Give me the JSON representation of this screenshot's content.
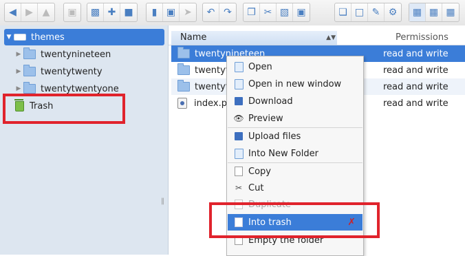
{
  "toolbar": {
    "groups": [
      {
        "buttons": [
          {
            "icon": "back-icon",
            "disabled": false
          },
          {
            "icon": "forward-icon",
            "disabled": true
          },
          {
            "icon": "up-icon",
            "disabled": true
          }
        ]
      },
      {
        "buttons": [
          {
            "icon": "home-icon",
            "disabled": true
          }
        ]
      },
      {
        "buttons": [
          {
            "icon": "open-icon",
            "disabled": false
          },
          {
            "icon": "new-file-icon",
            "disabled": false
          },
          {
            "icon": "save-icon",
            "disabled": false
          }
        ]
      },
      {
        "buttons": [
          {
            "icon": "book-icon",
            "disabled": false
          },
          {
            "icon": "floppy-icon",
            "disabled": false
          },
          {
            "icon": "pointer-icon",
            "disabled": true
          }
        ]
      },
      {
        "buttons": [
          {
            "icon": "undo-icon",
            "disabled": false
          },
          {
            "icon": "redo-icon",
            "disabled": false
          }
        ]
      },
      {
        "buttons": [
          {
            "icon": "copy-icon",
            "disabled": false
          },
          {
            "icon": "cut-icon",
            "disabled": false
          },
          {
            "icon": "paste-icon",
            "disabled": false
          },
          {
            "icon": "delete-icon",
            "disabled": false
          }
        ]
      },
      {
        "buttons": [
          {
            "icon": "duplicate-icon",
            "disabled": false
          },
          {
            "icon": "select-icon",
            "disabled": false
          },
          {
            "icon": "edit-icon",
            "disabled": false
          },
          {
            "icon": "settings-icon",
            "disabled": false
          }
        ]
      },
      {
        "buttons": [
          {
            "icon": "icons-view-icon",
            "active": true
          },
          {
            "icon": "grid-view-icon",
            "active": false
          },
          {
            "icon": "list-view-icon",
            "active": false
          }
        ]
      }
    ]
  },
  "tree": {
    "root": "themes",
    "children": [
      "twentynineteen",
      "twentytwenty",
      "twentytwentyone"
    ],
    "trash": "Trash"
  },
  "list": {
    "col_name": "Name",
    "col_permissions": "Permissions",
    "rows": [
      {
        "name": "twentynineteen",
        "permissions": "read and write",
        "type": "folder"
      },
      {
        "name": "twentytwenty",
        "permissions": "read and write",
        "type": "folder"
      },
      {
        "name": "twentytwentyone",
        "permissions": "read and write",
        "type": "folder"
      },
      {
        "name": "index.php",
        "permissions": "read and write",
        "type": "file"
      }
    ]
  },
  "context_menu": {
    "open": "Open",
    "open_new_window": "Open in new window",
    "download": "Download",
    "preview": "Preview",
    "upload_files": "Upload files",
    "into_new_folder": "Into New Folder",
    "copy": "Copy",
    "cut": "Cut",
    "duplicate": "Duplicate",
    "into_trash": "Into trash",
    "empty_folder": "Empty the folder"
  },
  "colors": {
    "accent": "#3b7dd8",
    "annotation": "#e0232c"
  }
}
